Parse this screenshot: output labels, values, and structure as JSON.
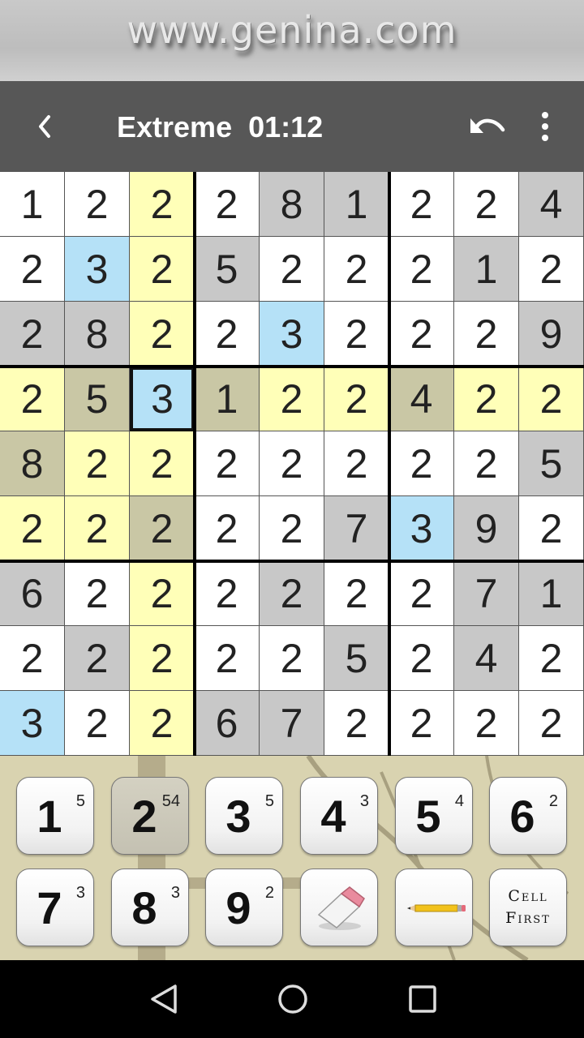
{
  "banner": {
    "text": "www.genina.com"
  },
  "toolbar": {
    "title": "Extreme  01:12"
  },
  "grid": {
    "values": [
      [
        "1",
        "2",
        "2",
        "2",
        "8",
        "1",
        "2",
        "2",
        "4"
      ],
      [
        "2",
        "3",
        "2",
        "5",
        "2",
        "2",
        "2",
        "1",
        "2"
      ],
      [
        "2",
        "8",
        "2",
        "2",
        "3",
        "2",
        "2",
        "2",
        "9"
      ],
      [
        "2",
        "5",
        "3",
        "1",
        "2",
        "2",
        "4",
        "2",
        "2"
      ],
      [
        "8",
        "2",
        "2",
        "2",
        "2",
        "2",
        "2",
        "2",
        "5"
      ],
      [
        "2",
        "2",
        "2",
        "2",
        "2",
        "7",
        "3",
        "9",
        "2"
      ],
      [
        "6",
        "2",
        "2",
        "2",
        "2",
        "2",
        "2",
        "7",
        "1"
      ],
      [
        "2",
        "2",
        "2",
        "2",
        "2",
        "5",
        "2",
        "4",
        "2"
      ],
      [
        "3",
        "2",
        "2",
        "6",
        "7",
        "2",
        "2",
        "2",
        "2"
      ]
    ],
    "shading": [
      [
        "w",
        "w",
        "y",
        "w",
        "g",
        "g",
        "w",
        "w",
        "g"
      ],
      [
        "w",
        "b",
        "y",
        "g",
        "w",
        "w",
        "w",
        "g",
        "w"
      ],
      [
        "g",
        "g",
        "y",
        "w",
        "b",
        "w",
        "w",
        "w",
        "g"
      ],
      [
        "y",
        "o",
        "b",
        "o",
        "y",
        "y",
        "o",
        "y",
        "y"
      ],
      [
        "o",
        "y",
        "y",
        "w",
        "w",
        "w",
        "w",
        "w",
        "g"
      ],
      [
        "y",
        "y",
        "o",
        "w",
        "w",
        "g",
        "b",
        "g",
        "w"
      ],
      [
        "g",
        "w",
        "y",
        "w",
        "g",
        "w",
        "w",
        "g",
        "g"
      ],
      [
        "w",
        "g",
        "y",
        "w",
        "w",
        "g",
        "w",
        "g",
        "w"
      ],
      [
        "b",
        "w",
        "y",
        "g",
        "g",
        "w",
        "w",
        "w",
        "w"
      ]
    ],
    "selected_cell": {
      "row": 3,
      "col": 2
    },
    "colors": {
      "w": "#ffffff",
      "g": "#c8c8c8",
      "y": "#ffffb8",
      "b": "#b5e1f7",
      "o": "#c9c7a5"
    }
  },
  "keypad": {
    "keys": [
      {
        "digit": "1",
        "count": "5"
      },
      {
        "digit": "2",
        "count": "54"
      },
      {
        "digit": "3",
        "count": "5"
      },
      {
        "digit": "4",
        "count": "3"
      },
      {
        "digit": "5",
        "count": "4"
      },
      {
        "digit": "6",
        "count": "2"
      },
      {
        "digit": "7",
        "count": "3"
      },
      {
        "digit": "8",
        "count": "3"
      },
      {
        "digit": "9",
        "count": "2"
      }
    ],
    "cell_first_line1": "Cell",
    "cell_first_line2": "First"
  },
  "icons": {
    "back": "chevron-left-icon",
    "undo": "undo-icon",
    "more": "more-vertical-icon",
    "eraser": "eraser-icon",
    "pencil": "pencil-icon",
    "nav_back": "triangle-back-icon",
    "nav_home": "circle-home-icon",
    "nav_recents": "square-recents-icon"
  }
}
